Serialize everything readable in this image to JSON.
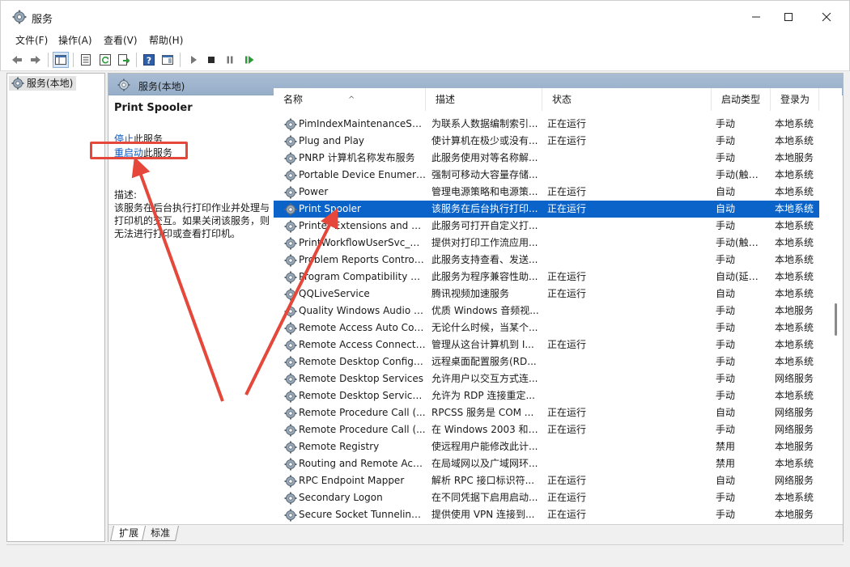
{
  "window": {
    "title": "服务"
  },
  "menu": {
    "items": [
      "文件(F)",
      "操作(A)",
      "查看(V)",
      "帮助(H)"
    ]
  },
  "tree": {
    "root_label": "服务(本地)"
  },
  "content_header": {
    "title": "服务(本地)"
  },
  "detail": {
    "service_title": "Print Spooler",
    "stop_link": "停止",
    "stop_suffix": "此服务",
    "restart_link": "重启动",
    "restart_suffix": "此服务",
    "description_label": "描述:",
    "description": "该服务在后台执行打印作业并处理与打印机的交互。如果关闭该服务，则无法进行打印或查看打印机。"
  },
  "columns": {
    "name": "名称",
    "description": "描述",
    "status": "状态",
    "startup": "启动类型",
    "logon": "登录为"
  },
  "services": [
    {
      "name": "PimIndexMaintenanceSvc...",
      "description": "为联系人数据编制索引...",
      "status": "正在运行",
      "startup": "手动",
      "logon": "本地系统"
    },
    {
      "name": "Plug and Play",
      "description": "使计算机在极少或没有...",
      "status": "正在运行",
      "startup": "手动",
      "logon": "本地系统"
    },
    {
      "name": "PNRP 计算机名称发布服务",
      "description": "此服务使用对等名称解...",
      "status": "",
      "startup": "手动",
      "logon": "本地服务"
    },
    {
      "name": "Portable Device Enumera...",
      "description": "强制可移动大容量存储...",
      "status": "",
      "startup": "手动(触发...",
      "logon": "本地系统"
    },
    {
      "name": "Power",
      "description": "管理电源策略和电源策...",
      "status": "正在运行",
      "startup": "自动",
      "logon": "本地系统"
    },
    {
      "name": "Print Spooler",
      "description": "该服务在后台执行打印...",
      "status": "正在运行",
      "startup": "自动",
      "logon": "本地系统",
      "selected": true
    },
    {
      "name": "Printer Extensions and N...",
      "description": "此服务可打开自定义打...",
      "status": "",
      "startup": "手动",
      "logon": "本地系统"
    },
    {
      "name": "PrintWorkflowUserSvc_82...",
      "description": "提供对打印工作流应用...",
      "status": "",
      "startup": "手动(触发...",
      "logon": "本地系统"
    },
    {
      "name": "Problem Reports Control...",
      "description": "此服务支持查看、发送...",
      "status": "",
      "startup": "手动",
      "logon": "本地系统"
    },
    {
      "name": "Program Compatibility A...",
      "description": "此服务为程序兼容性助...",
      "status": "正在运行",
      "startup": "自动(延迟...",
      "logon": "本地系统"
    },
    {
      "name": "QQLiveService",
      "description": "腾讯视频加速服务",
      "status": "正在运行",
      "startup": "自动",
      "logon": "本地系统"
    },
    {
      "name": "Quality Windows Audio V...",
      "description": "优质 Windows 音频视...",
      "status": "",
      "startup": "手动",
      "logon": "本地服务"
    },
    {
      "name": "Remote Access Auto Con...",
      "description": "无论什么时候，当某个...",
      "status": "",
      "startup": "手动",
      "logon": "本地系统"
    },
    {
      "name": "Remote Access Connecti...",
      "description": "管理从这台计算机到 I...",
      "status": "正在运行",
      "startup": "手动",
      "logon": "本地系统"
    },
    {
      "name": "Remote Desktop Configu...",
      "description": "远程桌面配置服务(RD...",
      "status": "",
      "startup": "手动",
      "logon": "本地系统"
    },
    {
      "name": "Remote Desktop Services",
      "description": "允许用户以交互方式连...",
      "status": "",
      "startup": "手动",
      "logon": "网络服务"
    },
    {
      "name": "Remote Desktop Service...",
      "description": "允许为 RDP 连接重定...",
      "status": "",
      "startup": "手动",
      "logon": "本地系统"
    },
    {
      "name": "Remote Procedure Call (...",
      "description": "RPCSS 服务是 COM ...",
      "status": "正在运行",
      "startup": "自动",
      "logon": "网络服务"
    },
    {
      "name": "Remote Procedure Call (...",
      "description": "在 Windows 2003 和 ...",
      "status": "正在运行",
      "startup": "手动",
      "logon": "网络服务"
    },
    {
      "name": "Remote Registry",
      "description": "使远程用户能修改此计...",
      "status": "",
      "startup": "禁用",
      "logon": "本地服务"
    },
    {
      "name": "Routing and Remote Acc...",
      "description": "在局域网以及广域网环...",
      "status": "",
      "startup": "禁用",
      "logon": "本地系统"
    },
    {
      "name": "RPC Endpoint Mapper",
      "description": "解析 RPC 接口标识符...",
      "status": "正在运行",
      "startup": "自动",
      "logon": "网络服务"
    },
    {
      "name": "Secondary Logon",
      "description": "在不同凭据下启用启动...",
      "status": "正在运行",
      "startup": "手动",
      "logon": "本地系统"
    },
    {
      "name": "Secure Socket Tunneling ...",
      "description": "提供使用 VPN 连接到...",
      "status": "正在运行",
      "startup": "手动",
      "logon": "本地服务"
    }
  ],
  "tabs": [
    "扩展",
    "标准"
  ],
  "colors": {
    "selection": "#0a63c9",
    "link": "#0a58c2",
    "annotation": "#e5483a",
    "header_band": "#a9bdd4"
  },
  "icons": {
    "app": "gear-icon",
    "service": "gear-icon"
  }
}
